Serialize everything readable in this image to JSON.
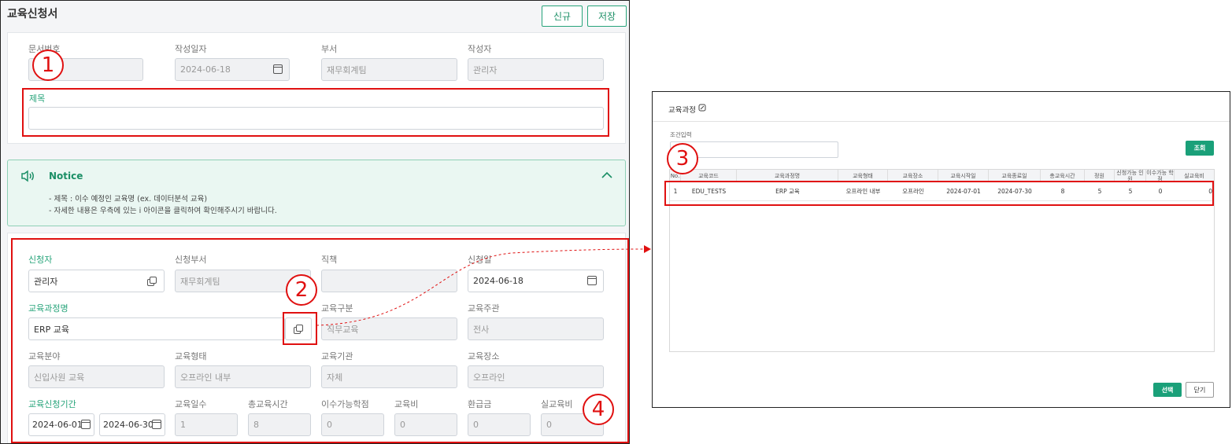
{
  "form": {
    "title": "교육신청서",
    "new_button": "신규",
    "save_button": "저장",
    "doc_number_label": "문서번호",
    "doc_number_value": "",
    "date_label": "작성일자",
    "date_value": "2024-06-18",
    "dept_label": "부서",
    "dept_value": "재무회계팀",
    "author_label": "작성자",
    "author_value": "관리자",
    "subject_label": "제목",
    "subject_value": ""
  },
  "notice": {
    "title": "Notice",
    "lines": [
      "- 제목 : 이수 예정인 교육명 (ex. 데이터분석 교육)",
      "- 자세한 내용은 우측에 있는 i 아이콘을 클릭하여 확인해주시기 바랍니다."
    ]
  },
  "detail": {
    "applicant_label": "신청자",
    "applicant_value": "관리자",
    "applicant_dept_label": "신청부서",
    "applicant_dept_value": "재무회계팀",
    "position_label": "직책",
    "position_value": "",
    "apply_date_label": "신청일",
    "apply_date_value": "2024-06-18",
    "course_name_label": "교육과정명",
    "course_name_value": "ERP 교육",
    "category_label": "교육구분",
    "category_value": "직무교육",
    "organizer_label": "교육주관",
    "organizer_value": "전사",
    "field_label": "교육분야",
    "field_value": "신입사원 교육",
    "format_label": "교육형태",
    "format_value": "오프라인 내부",
    "institution_label": "교육기관",
    "institution_value": "자체",
    "place_label": "교육장소",
    "place_value": "오프라인",
    "period_label": "교육신청기간",
    "period_start": "2024-06-01",
    "period_end": "2024-06-30",
    "days_label": "교육일수",
    "days_value": "1",
    "total_hours_label": "총교육시간",
    "total_hours_value": "8",
    "credits_label": "이수가능학점",
    "credits_value": "0",
    "fee_label": "교육비",
    "fee_value": "0",
    "refund_label": "환급금",
    "refund_value": "0",
    "actual_fee_label": "실교육비",
    "actual_fee_value": "0"
  },
  "markers": [
    "1",
    "2",
    "3",
    "4"
  ],
  "popup": {
    "title": "교육과정",
    "condition_label": "조건입력",
    "search_button": "조회",
    "select_button": "선택",
    "close_button": "닫기",
    "columns": [
      "No.",
      "교육코드",
      "교육과정명",
      "교육형태",
      "교육장소",
      "교육시작일",
      "교육종료일",
      "총교육시간",
      "정원",
      "신청가능 인원",
      "이수가능 학점",
      "실교육비"
    ],
    "rows": [
      [
        "1",
        "EDU_TESTS",
        "ERP 교육",
        "오프라인 내부",
        "오프라인",
        "2024-07-01",
        "2024-07-30",
        "8",
        "5",
        "5",
        "0",
        "0"
      ]
    ]
  },
  "colors": {
    "accent": "#27a47a",
    "highlight": "#e01010",
    "notice_bg": "#eaf7f2"
  },
  "icons": [
    "calendar-icon",
    "popup-icon",
    "speaker-icon",
    "chevron-up-icon",
    "edit-icon",
    "arrow-right-icon"
  ]
}
